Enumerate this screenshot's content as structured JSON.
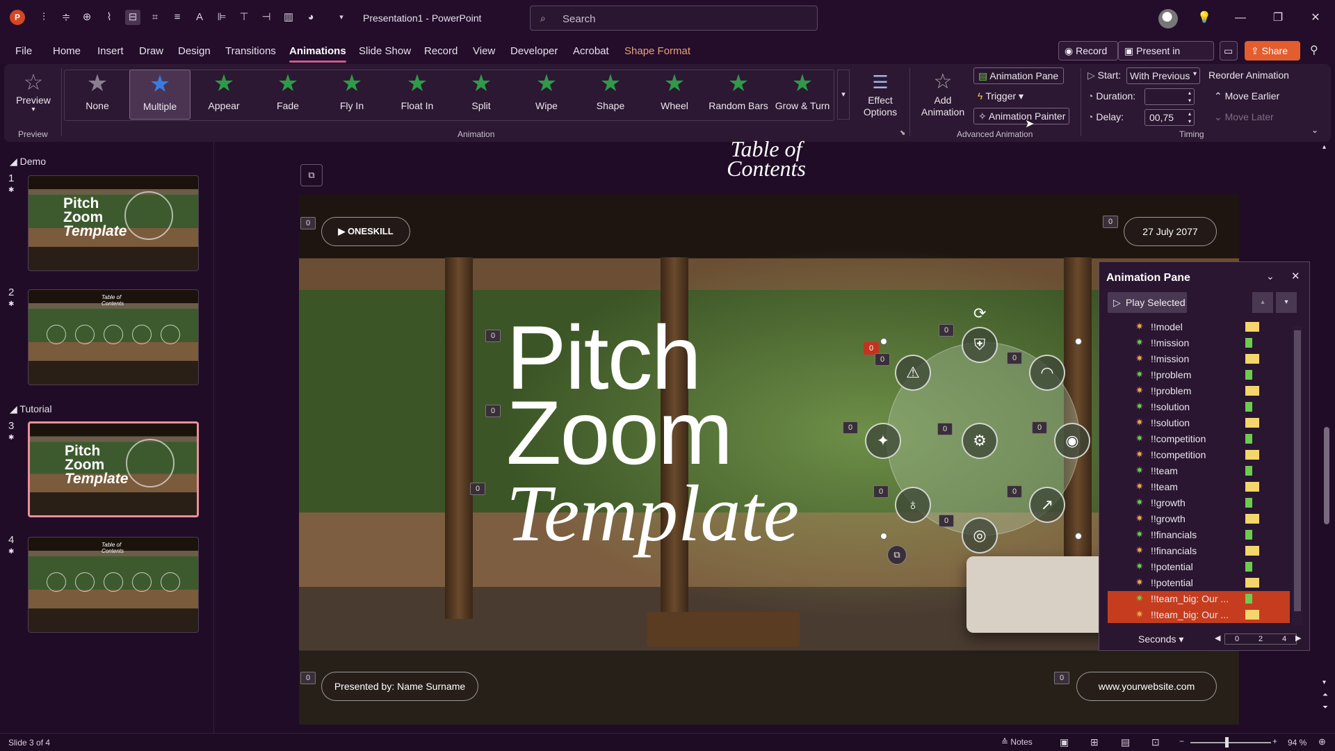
{
  "app": {
    "title": "Presentation1 - PowerPoint",
    "search_placeholder": "Search"
  },
  "menu": {
    "tabs": [
      "File",
      "Home",
      "Insert",
      "Draw",
      "Design",
      "Transitions",
      "Animations",
      "Slide Show",
      "Record",
      "View",
      "Developer",
      "Acrobat",
      "Shape Format"
    ],
    "active": "Animations",
    "record": "Record",
    "present_teams": "Present in Teams",
    "share": "Share"
  },
  "ribbon": {
    "preview_label": "Preview",
    "preview_group": "Preview",
    "animation_group": "Animation",
    "animations": [
      "None",
      "Multiple",
      "Appear",
      "Fade",
      "Fly In",
      "Float In",
      "Split",
      "Wipe",
      "Shape",
      "Wheel",
      "Random Bars",
      "Grow & Turn"
    ],
    "selected_animation": "Multiple",
    "effect_options": "Effect Options",
    "add_animation": "Add Animation",
    "animation_pane": "Animation Pane",
    "trigger": "Trigger",
    "animation_painter": "Animation Painter",
    "advanced_group": "Advanced Animation",
    "start_label": "Start:",
    "start_value": "With Previous",
    "duration_label": "Duration:",
    "duration_value": "",
    "delay_label": "Delay:",
    "delay_value": "00,75",
    "timing_group": "Timing",
    "reorder_title": "Reorder Animation",
    "move_earlier": "Move Earlier",
    "move_later": "Move Later"
  },
  "sections": [
    {
      "name": "Demo",
      "slides": [
        1,
        2
      ]
    },
    {
      "name": "Tutorial",
      "slides": [
        3,
        4
      ]
    }
  ],
  "thumbs": {
    "pitch_lines": [
      "Pitch",
      "Zoom",
      "Template"
    ],
    "toc_lines": [
      "Table of",
      "Contents"
    ]
  },
  "slide": {
    "toc_title": "Table of Contents",
    "toc_line1": "Table of",
    "toc_line2": "Contents",
    "brand": "ONESKILL",
    "date": "27 July 2077",
    "title_line1": "Pitch",
    "title_line2": "Zoom",
    "title_line3": "Template",
    "presenter": "Presented by: Name Surname",
    "website": "www.yourwebsite.com",
    "badge_zero": "0"
  },
  "animation_pane": {
    "title": "Animation Pane",
    "play_selected": "Play Selected",
    "items": [
      {
        "name": "!!model",
        "bar": "yellow"
      },
      {
        "name": "!!mission",
        "bar": "green"
      },
      {
        "name": "!!mission",
        "bar": "yellow"
      },
      {
        "name": "!!problem",
        "bar": "green"
      },
      {
        "name": "!!problem",
        "bar": "yellow"
      },
      {
        "name": "!!solution",
        "bar": "green"
      },
      {
        "name": "!!solution",
        "bar": "yellow"
      },
      {
        "name": "!!competition",
        "bar": "green"
      },
      {
        "name": "!!competition",
        "bar": "yellow"
      },
      {
        "name": "!!team",
        "bar": "green"
      },
      {
        "name": "!!team",
        "bar": "yellow"
      },
      {
        "name": "!!growth",
        "bar": "green"
      },
      {
        "name": "!!growth",
        "bar": "yellow"
      },
      {
        "name": "!!financials",
        "bar": "green"
      },
      {
        "name": "!!financials",
        "bar": "yellow"
      },
      {
        "name": "!!potential",
        "bar": "green"
      },
      {
        "name": "!!potential",
        "bar": "yellow"
      },
      {
        "name": "!!team_big: Our ...",
        "bar": "green"
      },
      {
        "name": "!!team_big: Our ...",
        "bar": "yellow"
      }
    ],
    "selected_from": 17,
    "seconds_label": "Seconds",
    "timeline": [
      "0",
      "2",
      "4"
    ]
  },
  "status": {
    "slide_info": "Slide 3 of 4",
    "notes": "Notes",
    "zoom": "94 %"
  },
  "colors": {
    "accent": "#c95b8d",
    "selection": "#c53d1e",
    "share": "#e35d2e",
    "bar_green": "#6ecb4f",
    "bar_yellow": "#f4d66b"
  }
}
